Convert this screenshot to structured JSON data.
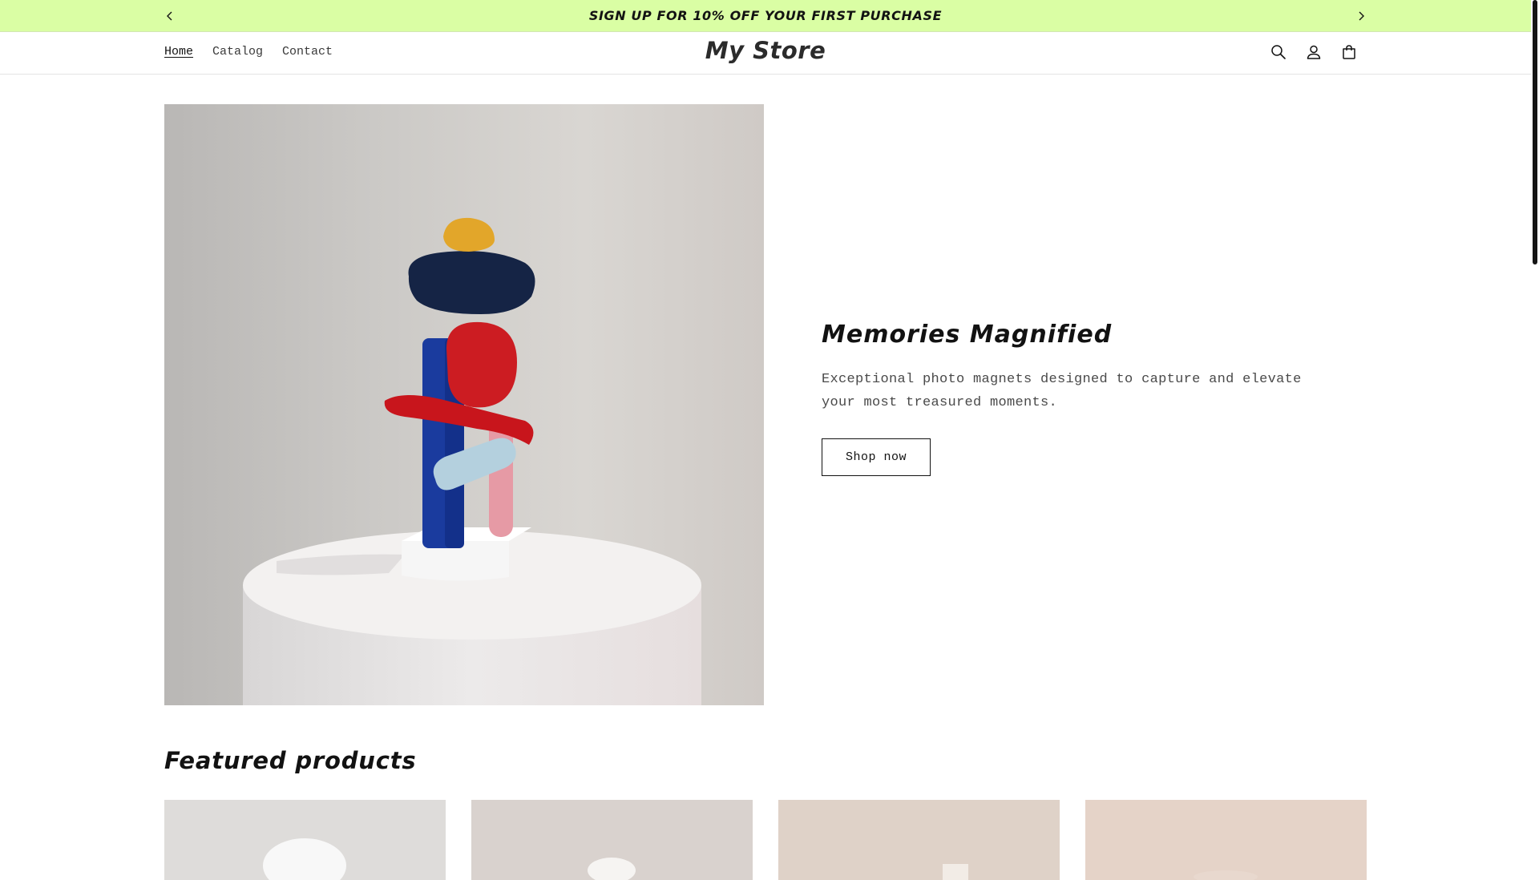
{
  "announcement": {
    "text": "SIGN UP FOR 10% OFF YOUR FIRST PURCHASE",
    "prev_icon": "chevron-left-icon",
    "next_icon": "chevron-right-icon",
    "background": "#dafea4"
  },
  "header": {
    "logo": "My Store",
    "nav": [
      {
        "label": "Home",
        "active": true
      },
      {
        "label": "Catalog",
        "active": false
      },
      {
        "label": "Contact",
        "active": false
      }
    ],
    "icons": [
      "search-icon",
      "account-icon",
      "cart-icon"
    ]
  },
  "hero": {
    "title": "Memories Magnified",
    "subtitle": "Exceptional photo magnets designed to capture and elevate your most treasured moments.",
    "button_label": "Shop now"
  },
  "featured": {
    "title": "Featured products",
    "products": [
      {
        "image": "product-image"
      },
      {
        "image": "product-image"
      },
      {
        "image": "product-image"
      },
      {
        "image": "product-image"
      }
    ]
  }
}
